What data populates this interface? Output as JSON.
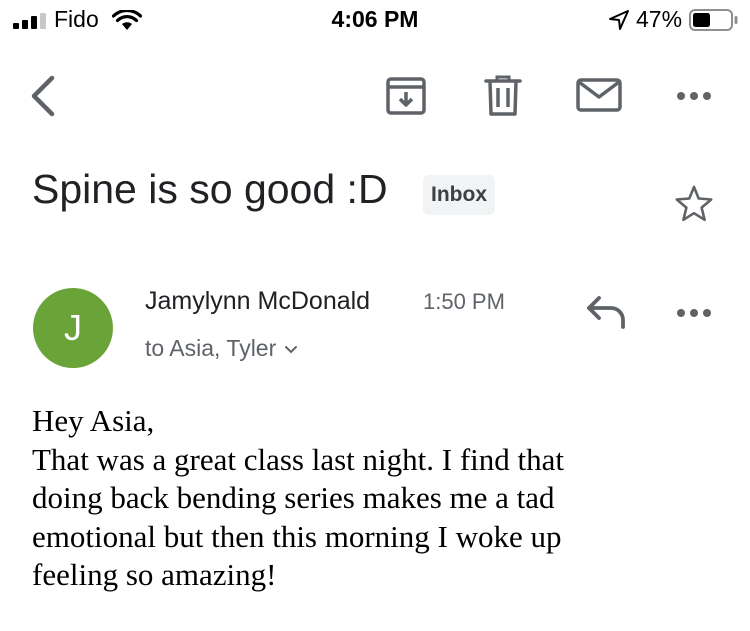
{
  "status_bar": {
    "carrier": "Fido",
    "time": "4:06 PM",
    "battery_percent": "47%",
    "battery_level": 0.47,
    "signal_bars": 3
  },
  "toolbar": {
    "icons": [
      "back-icon",
      "archive-icon",
      "trash-icon",
      "mail-icon",
      "more-icon"
    ]
  },
  "email": {
    "subject": "Spine is so good :D",
    "label": "Inbox",
    "sender_initial": "J",
    "sender_name": "Jamylynn McDonald",
    "sent_time": "1:50 PM",
    "recipients": "to Asia, Tyler",
    "body_lines": [
      "Hey Asia,",
      "That was a great class last night. I find that",
      "doing back bending series makes me a tad",
      "emotional but then this morning I woke up",
      "feeling so amazing!"
    ]
  },
  "colors": {
    "avatar": "#6aa338",
    "icon": "#5f6368",
    "chip_bg": "#f1f3f4"
  }
}
